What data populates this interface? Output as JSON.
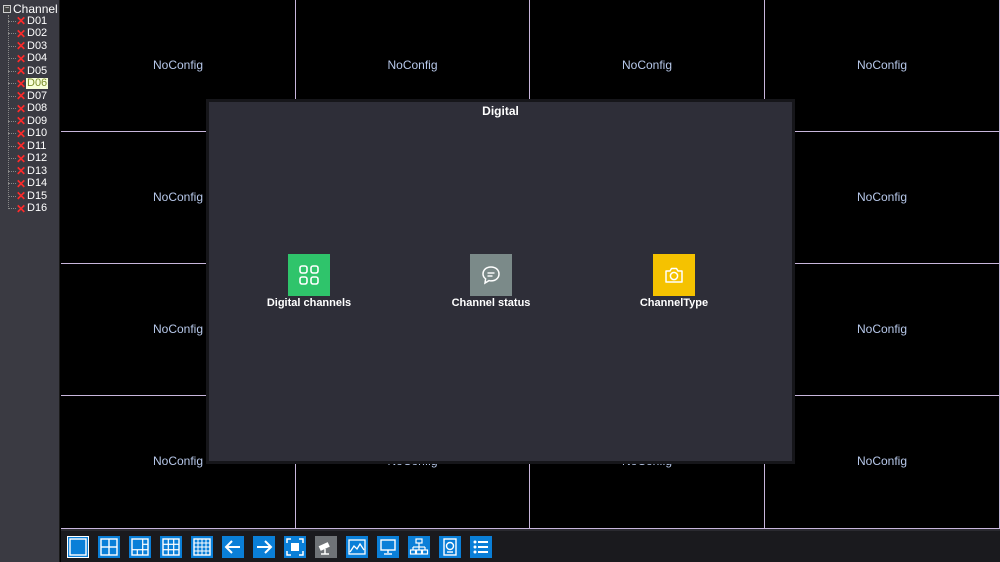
{
  "sidebar": {
    "root_label": "Channel",
    "channels": [
      {
        "label": "D01",
        "status": "error"
      },
      {
        "label": "D02",
        "status": "error"
      },
      {
        "label": "D03",
        "status": "error"
      },
      {
        "label": "D04",
        "status": "error"
      },
      {
        "label": "D05",
        "status": "error"
      },
      {
        "label": "D06",
        "status": "error",
        "selected": true
      },
      {
        "label": "D07",
        "status": "error"
      },
      {
        "label": "D08",
        "status": "error"
      },
      {
        "label": "D09",
        "status": "error"
      },
      {
        "label": "D10",
        "status": "error"
      },
      {
        "label": "D11",
        "status": "error"
      },
      {
        "label": "D12",
        "status": "error"
      },
      {
        "label": "D13",
        "status": "error"
      },
      {
        "label": "D14",
        "status": "error"
      },
      {
        "label": "D15",
        "status": "error"
      },
      {
        "label": "D16",
        "status": "error"
      }
    ]
  },
  "grid": {
    "cell_label": "NoConfig",
    "rows": 4,
    "cols": 4
  },
  "dialog": {
    "title": "Digital",
    "options": [
      {
        "label": "Digital channels",
        "icon": "grid-icon",
        "color": "#2fc46b"
      },
      {
        "label": "Channel status",
        "icon": "chat-bubble-icon",
        "color": "#7b8a89"
      },
      {
        "label": "ChannelType",
        "icon": "camera-icon",
        "color": "#f5c200"
      }
    ]
  },
  "toolbar": {
    "buttons": [
      {
        "name": "single-view-button",
        "icon": "single-view-icon"
      },
      {
        "name": "quad-view-button",
        "icon": "quad-view-icon"
      },
      {
        "name": "six-view-button",
        "icon": "six-view-icon"
      },
      {
        "name": "nine-view-button",
        "icon": "nine-view-icon"
      },
      {
        "name": "sixteen-view-button",
        "icon": "sixteen-view-icon"
      },
      {
        "name": "previous-page-button",
        "icon": "arrow-left-icon"
      },
      {
        "name": "next-page-button",
        "icon": "arrow-right-icon"
      },
      {
        "name": "fullscreen-button",
        "icon": "fullscreen-icon"
      },
      {
        "name": "ptz-button",
        "icon": "camera-ptz-icon",
        "disabled": true
      },
      {
        "name": "picture-settings-button",
        "icon": "picture-icon"
      },
      {
        "name": "monitor-button",
        "icon": "monitor-icon"
      },
      {
        "name": "network-button",
        "icon": "network-icon"
      },
      {
        "name": "storage-button",
        "icon": "storage-icon"
      },
      {
        "name": "menu-button",
        "icon": "list-icon"
      }
    ],
    "accent": "#0a7fd8"
  }
}
